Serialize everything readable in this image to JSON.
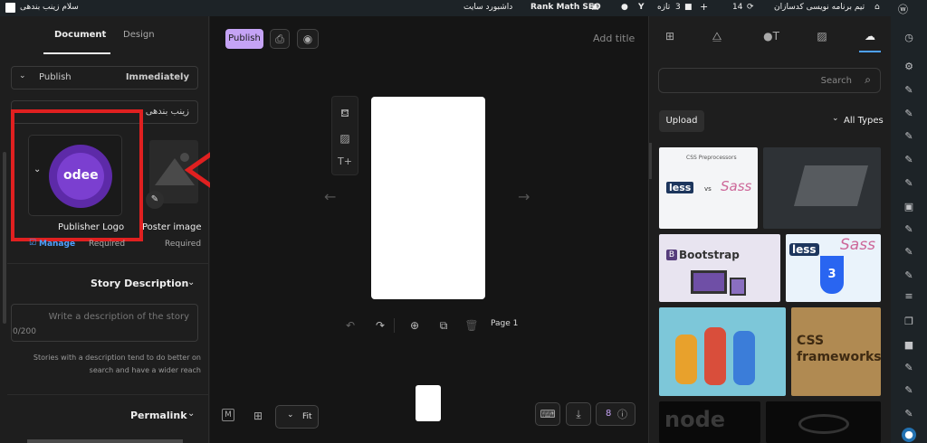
{
  "adminbar": {
    "site_greeting": "سلام زینب بندهی",
    "dashboard": "داشبورد سایت",
    "rankmath": "Rank Math SEO",
    "comments_count": "3",
    "new_label": "تازه",
    "updates_count": "14",
    "site_name": "تیم برنامه نویسی کدسازان"
  },
  "left": {
    "tab_document": "Document",
    "tab_design": "Design",
    "publish_label": "Publish",
    "publish_value": "Immediately",
    "author_value": "زینب بندهی",
    "logo_text": "odee",
    "publisher_logo": "Publisher Logo",
    "poster_image": "Poster image",
    "manage": "Manage",
    "required1": "Required",
    "required2": "Required",
    "story_desc_title": "Story Description",
    "desc_placeholder": "Write a description of the story",
    "char_count": "0/200",
    "desc_help": "Stories with a description tend to do better on search and have a wider reach",
    "permalink": "Permalink"
  },
  "canvas": {
    "publish_button": "Publish",
    "add_title": "Add title",
    "page_label": "Page 1",
    "zoom": "Fit",
    "help_count": "8"
  },
  "right": {
    "search_placeholder": "Search",
    "upload": "Upload",
    "all_types": "All Types",
    "media": {
      "t1_title": "CSS Preprocessors",
      "t1_less": "less",
      "t1_vs": "vs",
      "t1_sass": "Sass",
      "t3_text": "Bootstrap",
      "t4_less": "less",
      "t4_sass": "Sass",
      "t6_text": "CSS frameworks",
      "t7_text": "node"
    }
  },
  "colors": {
    "accent": "#c5a3f5",
    "annotation": "#e02020",
    "logo_purple": "#6b2fb8"
  }
}
